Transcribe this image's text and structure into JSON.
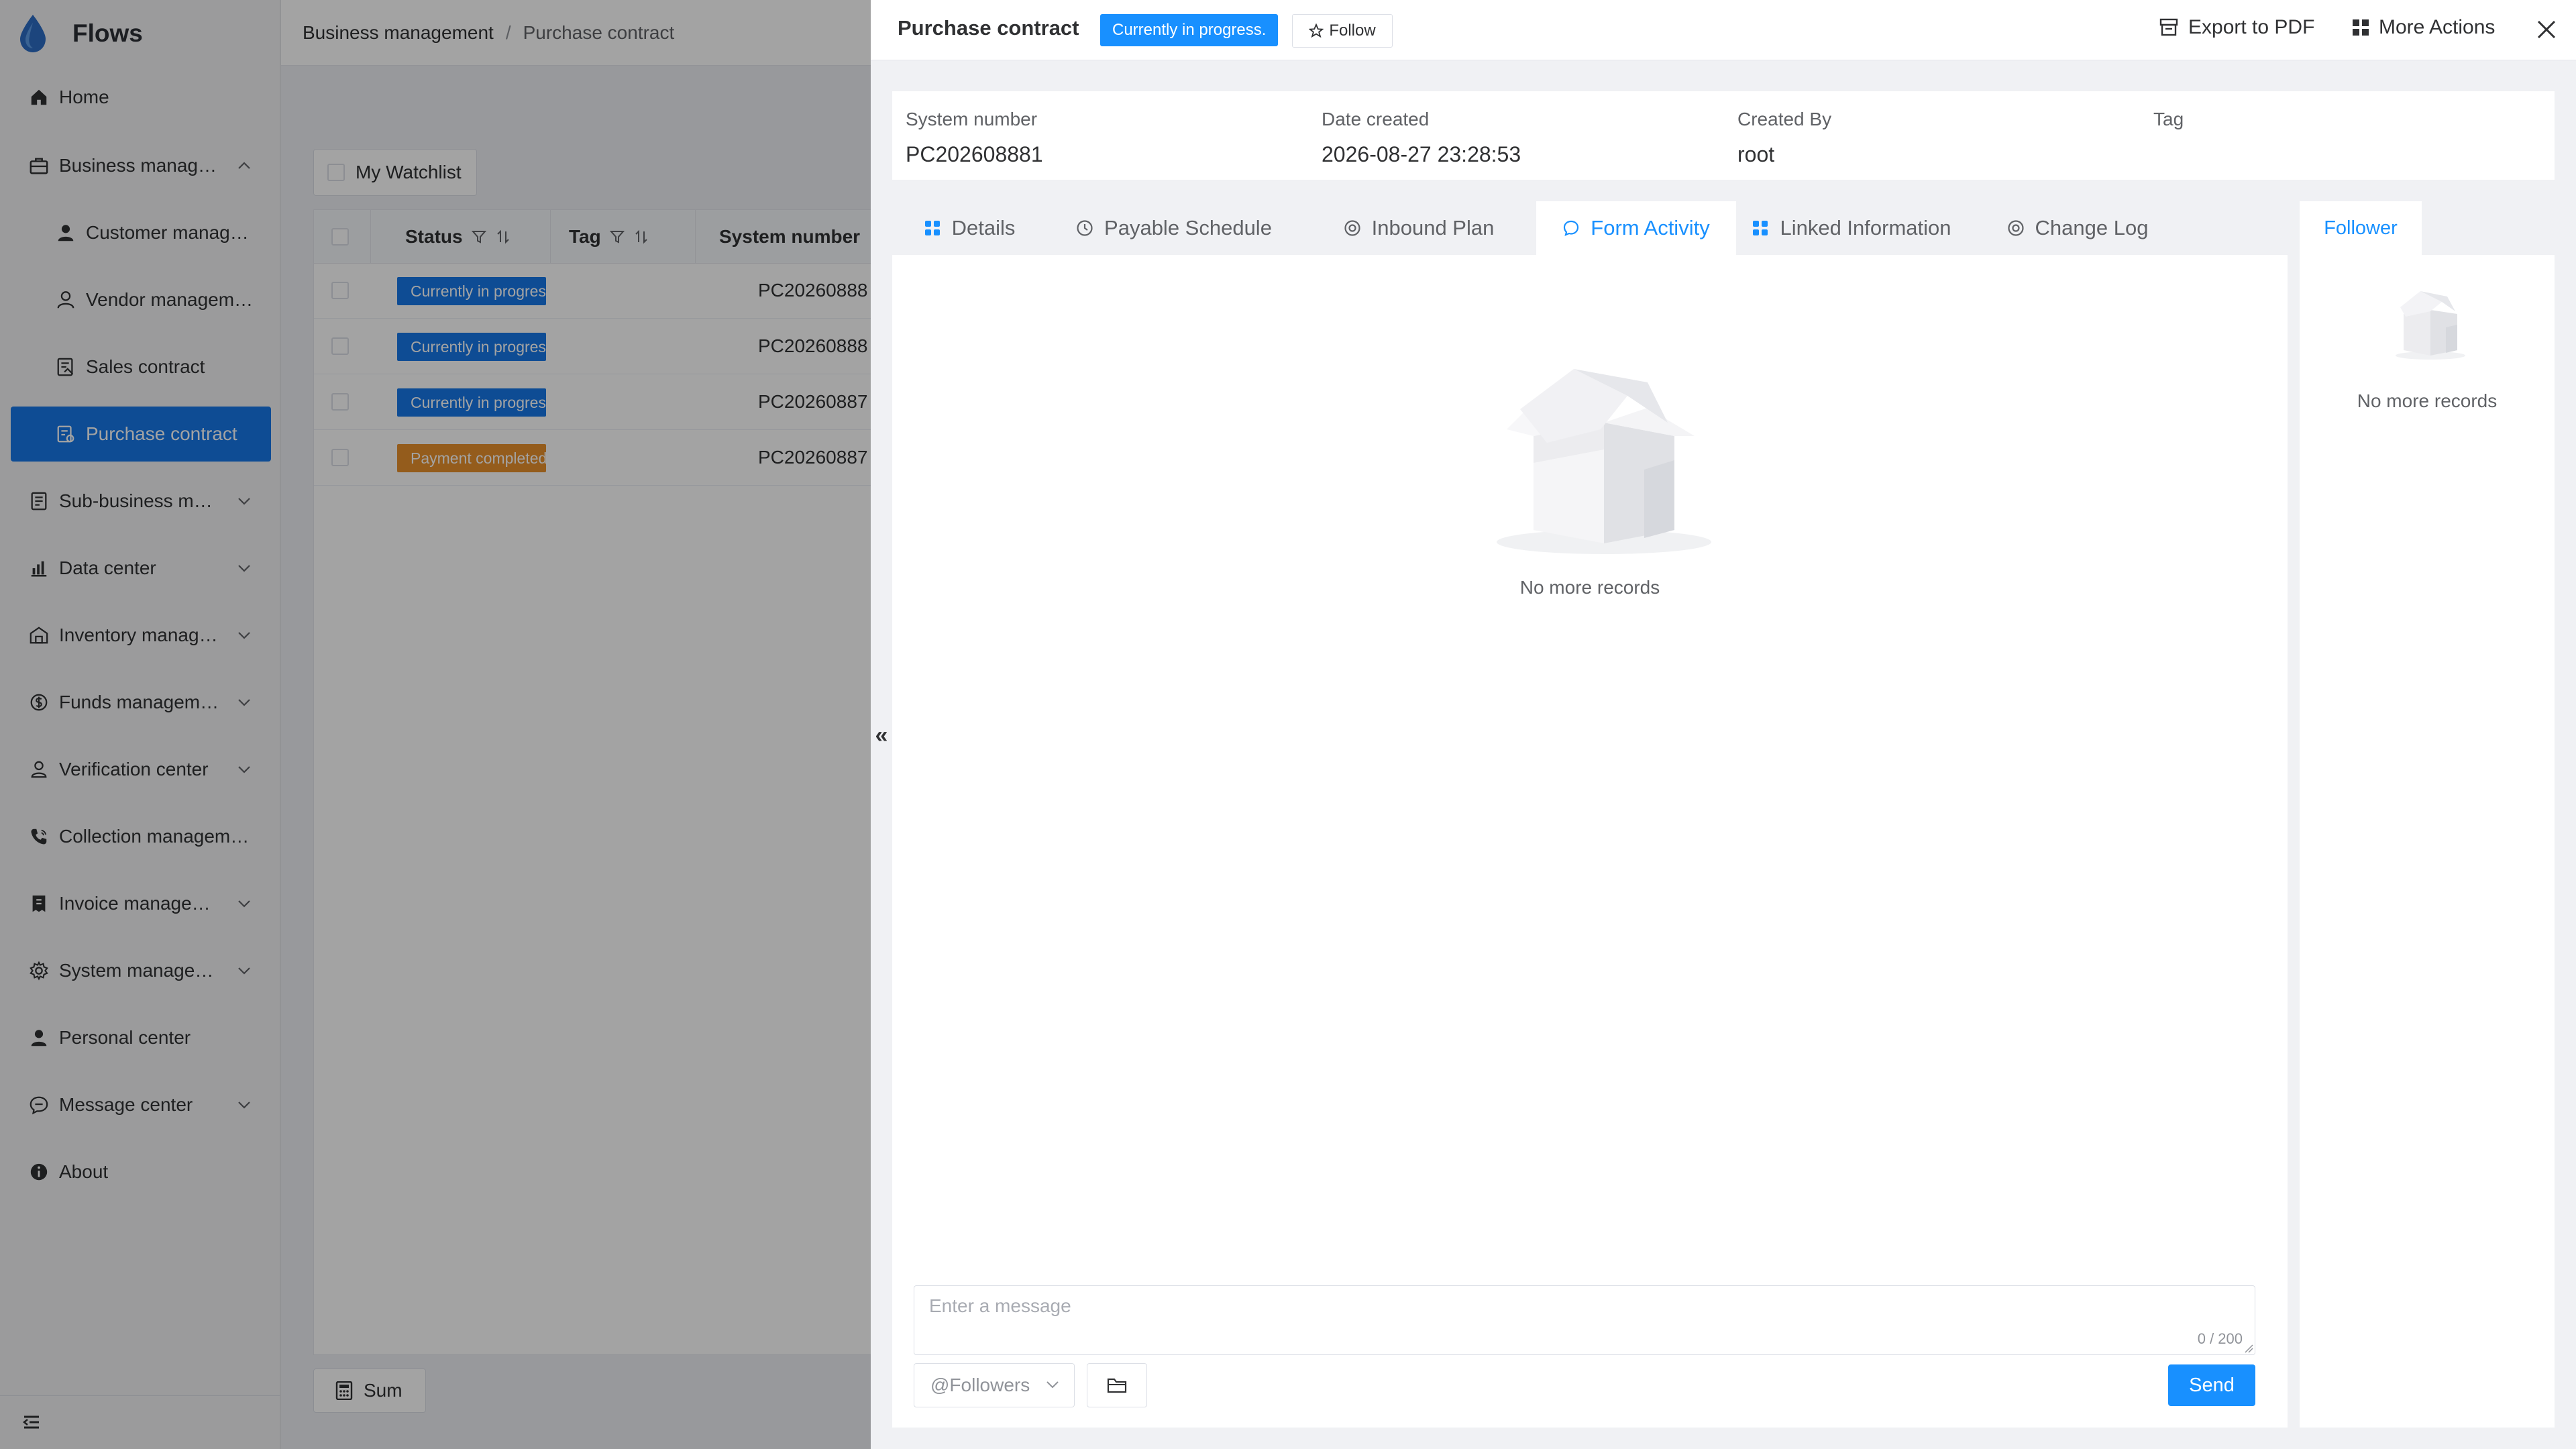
{
  "app": {
    "name": "Flows"
  },
  "sidebar": {
    "items": [
      {
        "label": "Home",
        "icon": "home-icon",
        "expandable": false
      },
      {
        "label": "Business manag…",
        "icon": "briefcase-icon",
        "expandable": true,
        "expanded": true
      },
      {
        "label": "Customer manag…",
        "icon": "user-icon",
        "sub": true
      },
      {
        "label": "Vendor managem…",
        "icon": "user-outline-icon",
        "sub": true
      },
      {
        "label": "Sales contract",
        "icon": "contract-icon",
        "sub": true
      },
      {
        "label": "Purchase contract",
        "icon": "purchase-icon",
        "sub": true,
        "active": true
      },
      {
        "label": "Sub-business m…",
        "icon": "document-icon",
        "expandable": true
      },
      {
        "label": "Data center",
        "icon": "bar-chart-icon",
        "expandable": true
      },
      {
        "label": "Inventory manag…",
        "icon": "warehouse-icon",
        "expandable": true
      },
      {
        "label": "Funds managem…",
        "icon": "coin-icon",
        "expandable": true
      },
      {
        "label": "Verification center",
        "icon": "person-check-icon",
        "expandable": true
      },
      {
        "label": "Collection managem…",
        "icon": "phone-icon",
        "expandable": false
      },
      {
        "label": "Invoice manage…",
        "icon": "invoice-icon",
        "expandable": true
      },
      {
        "label": "System manage…",
        "icon": "gear-icon",
        "expandable": true
      },
      {
        "label": "Personal center",
        "icon": "person-icon",
        "expandable": false
      },
      {
        "label": "Message center",
        "icon": "chat-icon",
        "expandable": true
      },
      {
        "label": "About",
        "icon": "info-icon",
        "expandable": false
      }
    ]
  },
  "breadcrumb": {
    "parent": "Business management",
    "separator": "/",
    "current": "Purchase contract"
  },
  "list": {
    "watchlist_label": "My Watchlist",
    "columns": {
      "status": "Status",
      "tag": "Tag",
      "system_number": "System number"
    },
    "rows": [
      {
        "status": "Currently in progress",
        "status_type": "progress",
        "system_number": "PC20260888"
      },
      {
        "status": "Currently in progress",
        "status_type": "progress",
        "system_number": "PC20260888"
      },
      {
        "status": "Currently in progress",
        "status_type": "progress",
        "system_number": "PC20260887"
      },
      {
        "status": "Payment completed",
        "status_type": "paid",
        "system_number": "PC20260887"
      }
    ],
    "sum_label": "Sum"
  },
  "drawer": {
    "title": "Purchase contract",
    "status": "Currently in progress.",
    "follow_label": "Follow",
    "export_label": "Export to PDF",
    "more_label": "More Actions",
    "info": {
      "system_number_label": "System number",
      "system_number": "PC202608881",
      "date_created_label": "Date created",
      "date_created": "2026-08-27 23:28:53",
      "created_by_label": "Created By",
      "created_by": "root",
      "tag_label": "Tag",
      "tag": ""
    },
    "tabs": [
      {
        "label": "Details",
        "icon": "grid-icon"
      },
      {
        "label": "Payable Schedule",
        "icon": "clock-icon"
      },
      {
        "label": "Inbound Plan",
        "icon": "target-icon"
      },
      {
        "label": "Form Activity",
        "icon": "chat-bubble-icon",
        "active": true
      },
      {
        "label": "Linked Information",
        "icon": "grid-icon"
      },
      {
        "label": "Change Log",
        "icon": "target-icon"
      }
    ],
    "empty_text": "No more records",
    "message": {
      "placeholder": "Enter a message",
      "count": "0 / 200"
    },
    "followers_select": "@Followers",
    "send_label": "Send",
    "follower_tab": "Follower",
    "follower_empty": "No more records"
  },
  "colors": {
    "primary": "#1890ff",
    "active_menu": "#1677e8",
    "status_progress": "#1677e8",
    "status_paid": "#e8912c"
  }
}
